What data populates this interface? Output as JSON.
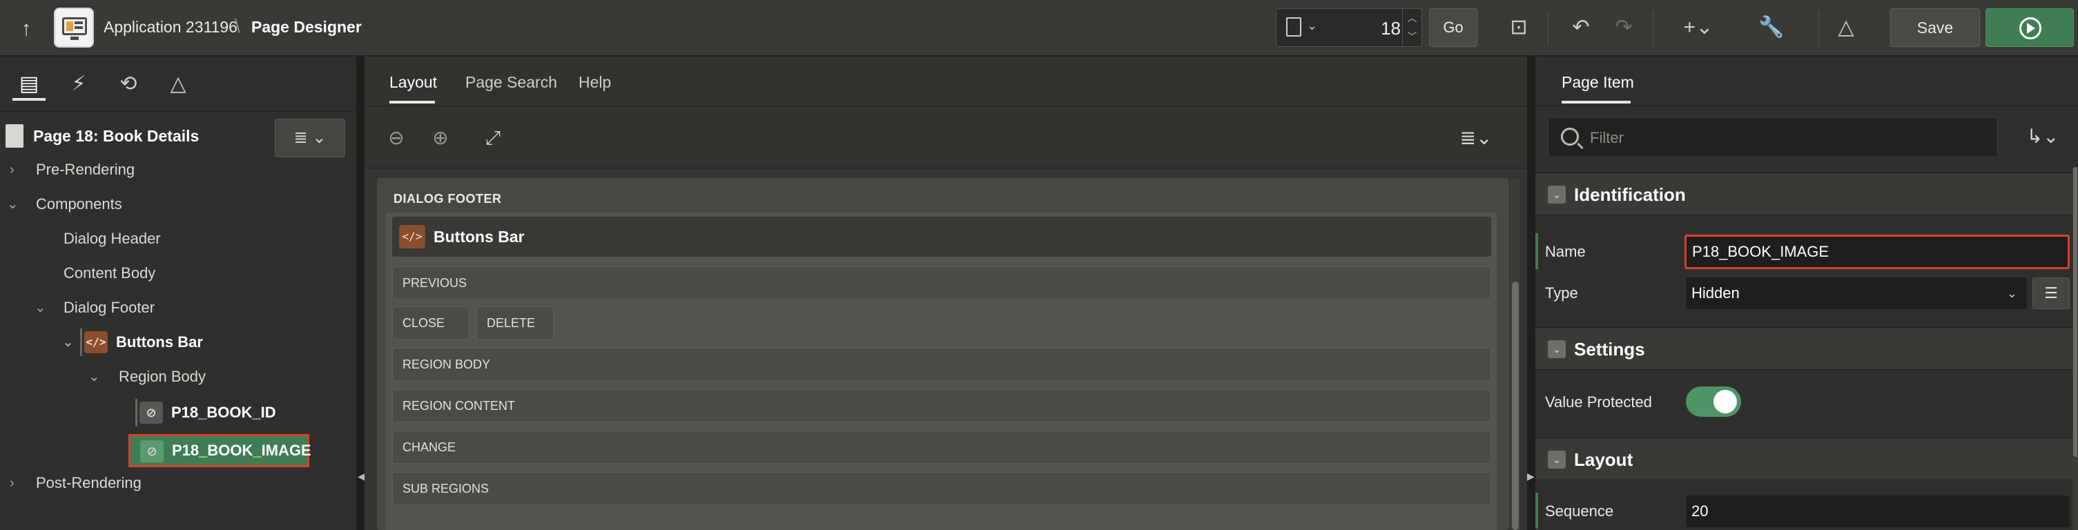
{
  "header": {
    "application": "Application 231196",
    "separator": "\\",
    "page_designer": "Page Designer",
    "page_number": "18",
    "go_label": "Go",
    "save_label": "Save"
  },
  "left_panel": {
    "page_title": "Page 18: Book Details",
    "tree": {
      "pre_rendering": "Pre-Rendering",
      "components": "Components",
      "dialog_header": "Dialog Header",
      "content_body": "Content Body",
      "dialog_footer": "Dialog Footer",
      "buttons_bar": "Buttons Bar",
      "region_body": "Region Body",
      "p18_book_id": "P18_BOOK_ID",
      "p18_book_image": "P18_BOOK_IMAGE",
      "post_rendering": "Post-Rendering"
    }
  },
  "center": {
    "tabs": [
      "Layout",
      "Page Search",
      "Help"
    ],
    "active_tab": "Layout",
    "dialog_footer_label": "DIALOG FOOTER",
    "region_title": "Buttons Bar",
    "positions": {
      "previous": "PREVIOUS",
      "close": "CLOSE",
      "delete": "DELETE",
      "region_body": "REGION BODY",
      "region_content": "REGION CONTENT",
      "change": "CHANGE",
      "sub_regions": "SUB REGIONS"
    }
  },
  "right_panel": {
    "tab": "Page Item",
    "filter_placeholder": "Filter",
    "sections": {
      "identification": "Identification",
      "settings": "Settings",
      "layout": "Layout"
    },
    "props": {
      "name_label": "Name",
      "name_value": "P18_BOOK_IMAGE",
      "type_label": "Type",
      "type_value": "Hidden",
      "value_protected_label": "Value Protected",
      "value_protected": true,
      "sequence_label": "Sequence",
      "sequence_value": "20"
    }
  },
  "colors": {
    "accent_green": "#3f7d55",
    "highlight_red": "#d9412f",
    "region_icon": "#8a4f2e"
  }
}
